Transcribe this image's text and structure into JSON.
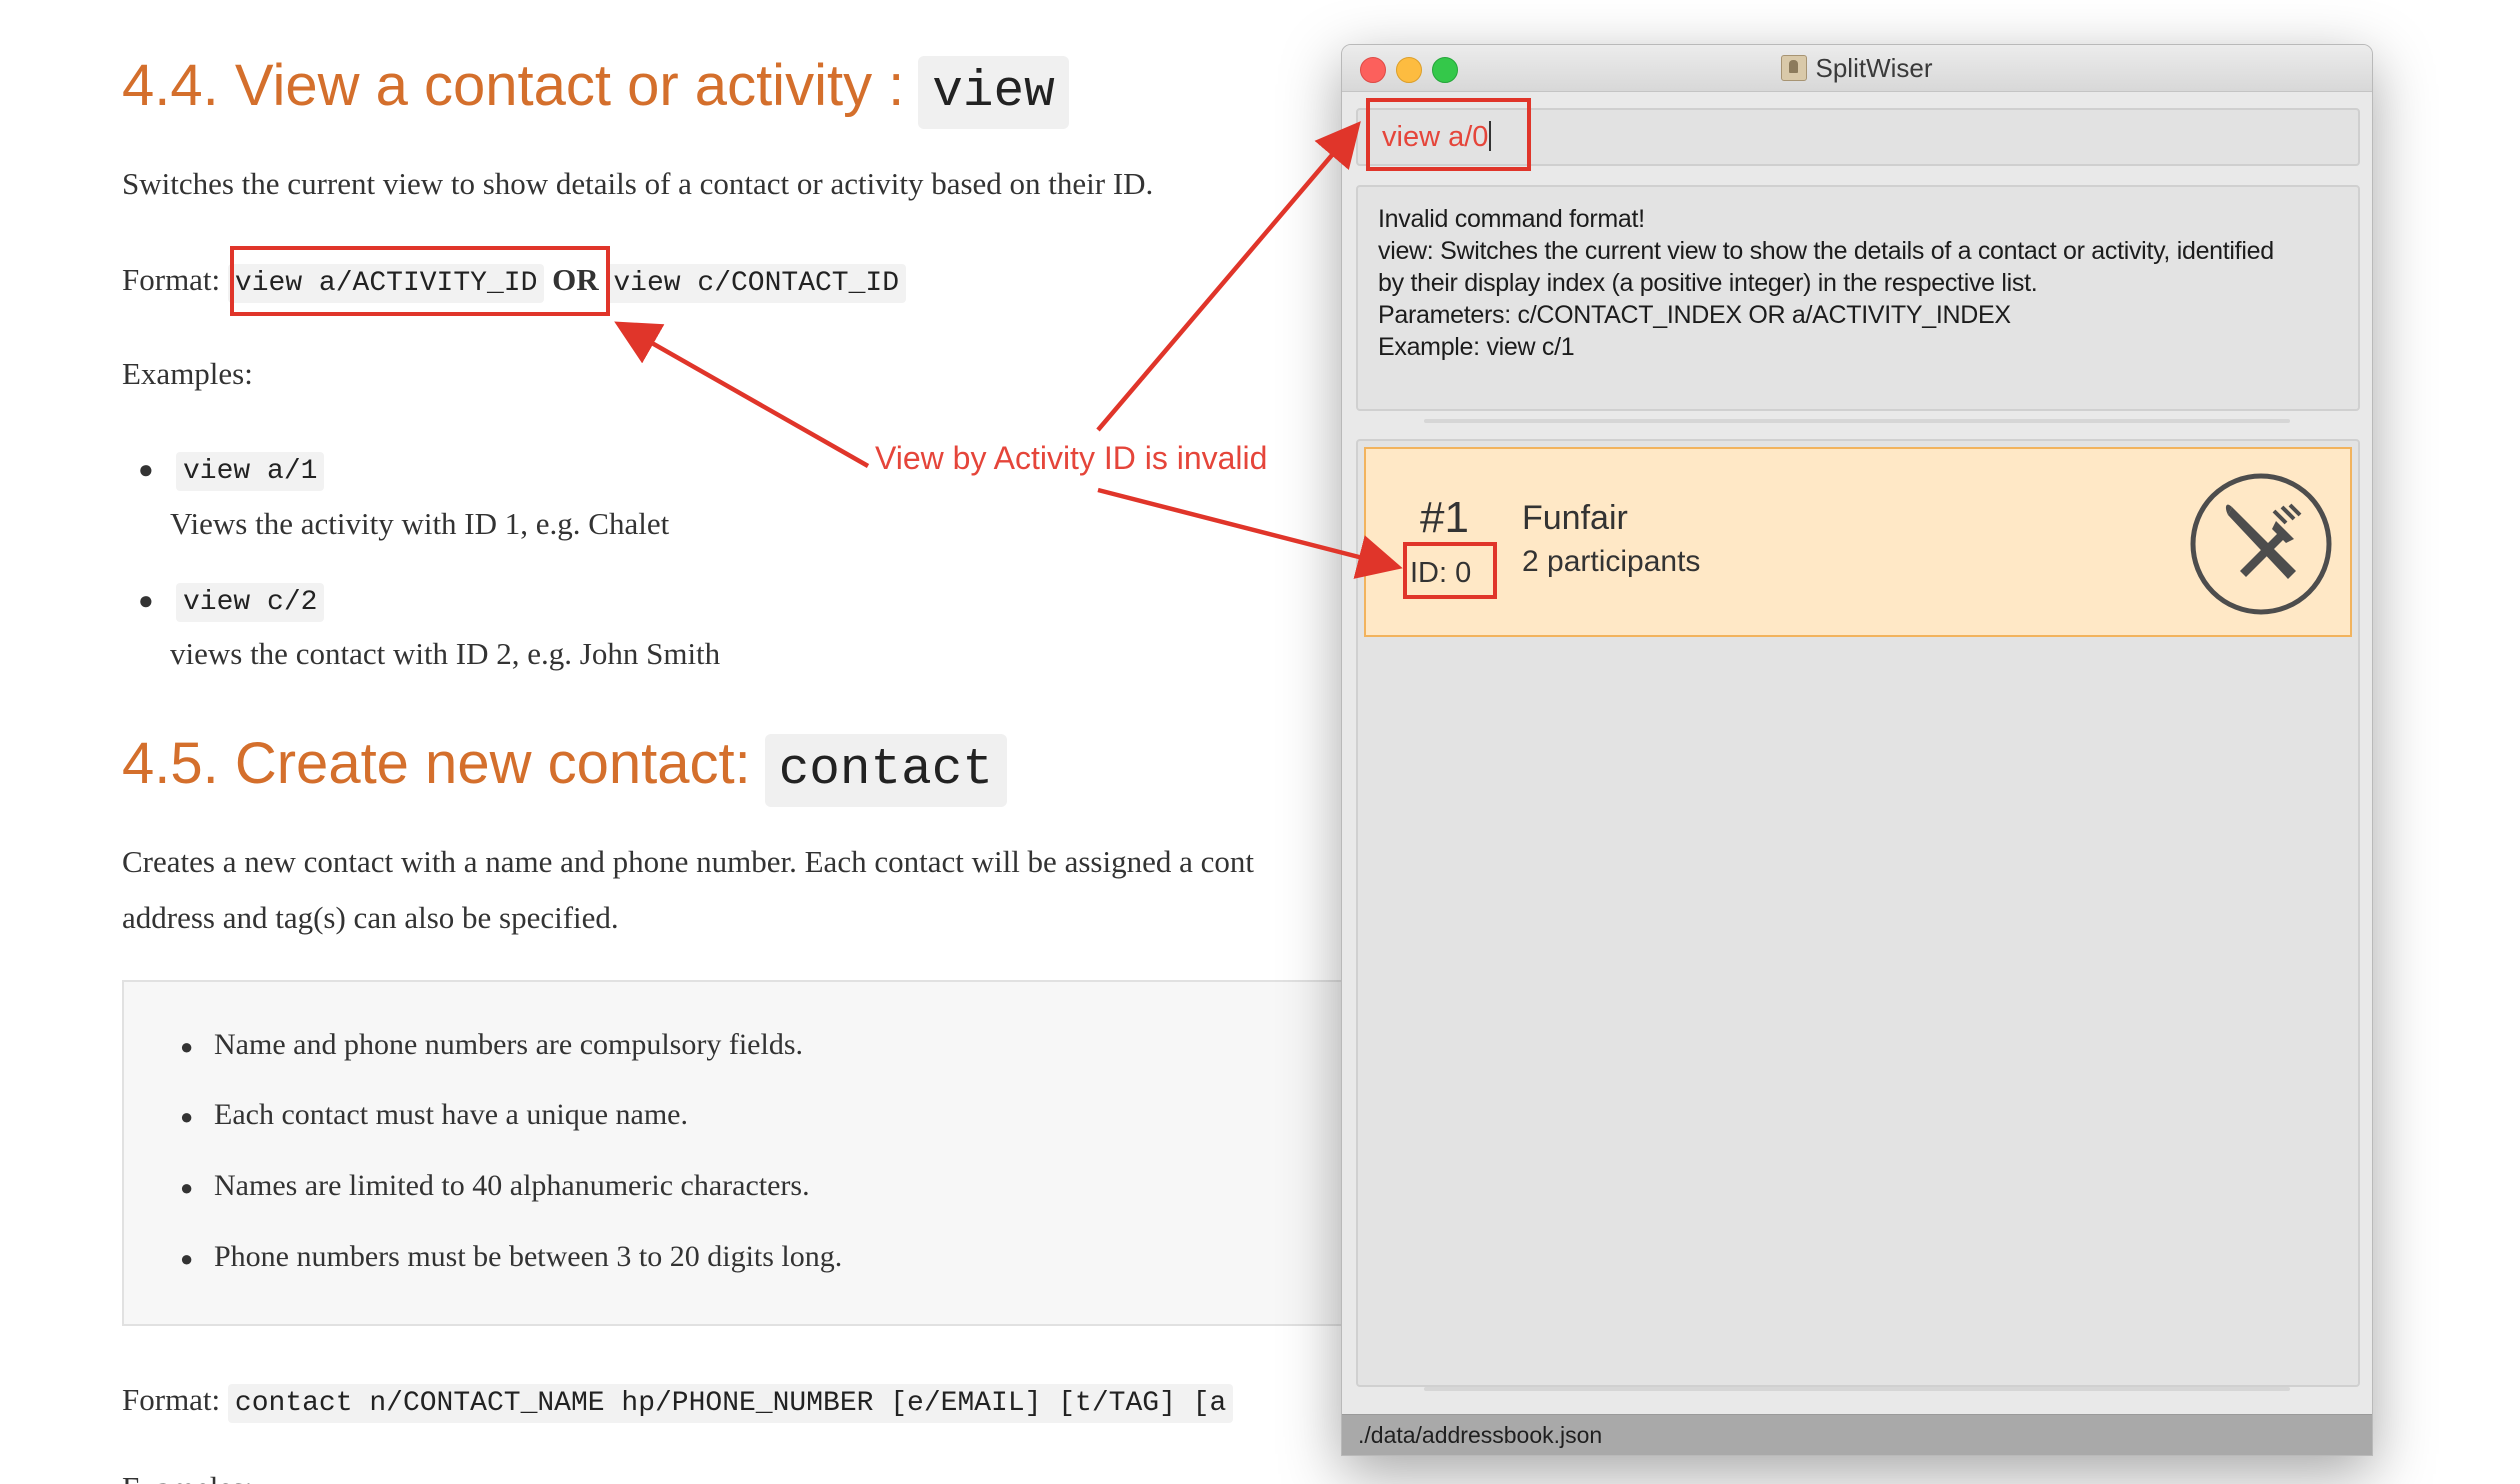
{
  "doc": {
    "section_4_4": {
      "title": "4.4. View a contact or activity :",
      "code": "view",
      "description": "Switches the current view to show details of a contact or activity based on their ID.",
      "format_label": "Format:",
      "format_code_1": "view a/ACTIVITY_ID",
      "format_or": "OR",
      "format_code_2": "view c/CONTACT_ID",
      "examples_label": "Examples:",
      "examples": [
        {
          "code": "view a/1",
          "text": "Views the activity with ID 1, e.g. Chalet"
        },
        {
          "code": "view c/2",
          "text": "views the contact with ID 2, e.g. John Smith"
        }
      ]
    },
    "section_4_5": {
      "title": "4.5. Create new contact:",
      "code": "contact",
      "description_line1": "Creates a new contact with a name and phone number. Each contact will be assigned a cont",
      "description_line2": "address and tag(s) can also be specified.",
      "notes": [
        "Name and phone numbers are compulsory fields.",
        "Each contact must have a unique name.",
        "Names are limited to 40 alphanumeric characters.",
        "Phone numbers must be between 3 to 20 digits long."
      ],
      "format_label": "Format:",
      "format_code": "contact n/CONTACT_NAME hp/PHONE_NUMBER [e/EMAIL] [t/TAG] [a",
      "examples_label": "Examples:"
    }
  },
  "window": {
    "title": "SplitWiser",
    "command_input": "view a/0",
    "result_lines": [
      "Invalid command format!",
      "view: Switches the current view to show the details of a contact or activity, identified",
      "by their display index (a positive integer) in the respective list.",
      "Parameters: c/CONTACT_INDEX OR a/ACTIVITY_INDEX",
      "Example: view c/1"
    ],
    "card": {
      "number": "#1",
      "id": "ID: 0",
      "name": "Funfair",
      "participants": "2 participants",
      "icon": "fork-knife-icon"
    },
    "status_path": "./data/addressbook.json"
  },
  "annotation": {
    "label": "View by Activity ID is invalid",
    "color": "#e5453a"
  }
}
